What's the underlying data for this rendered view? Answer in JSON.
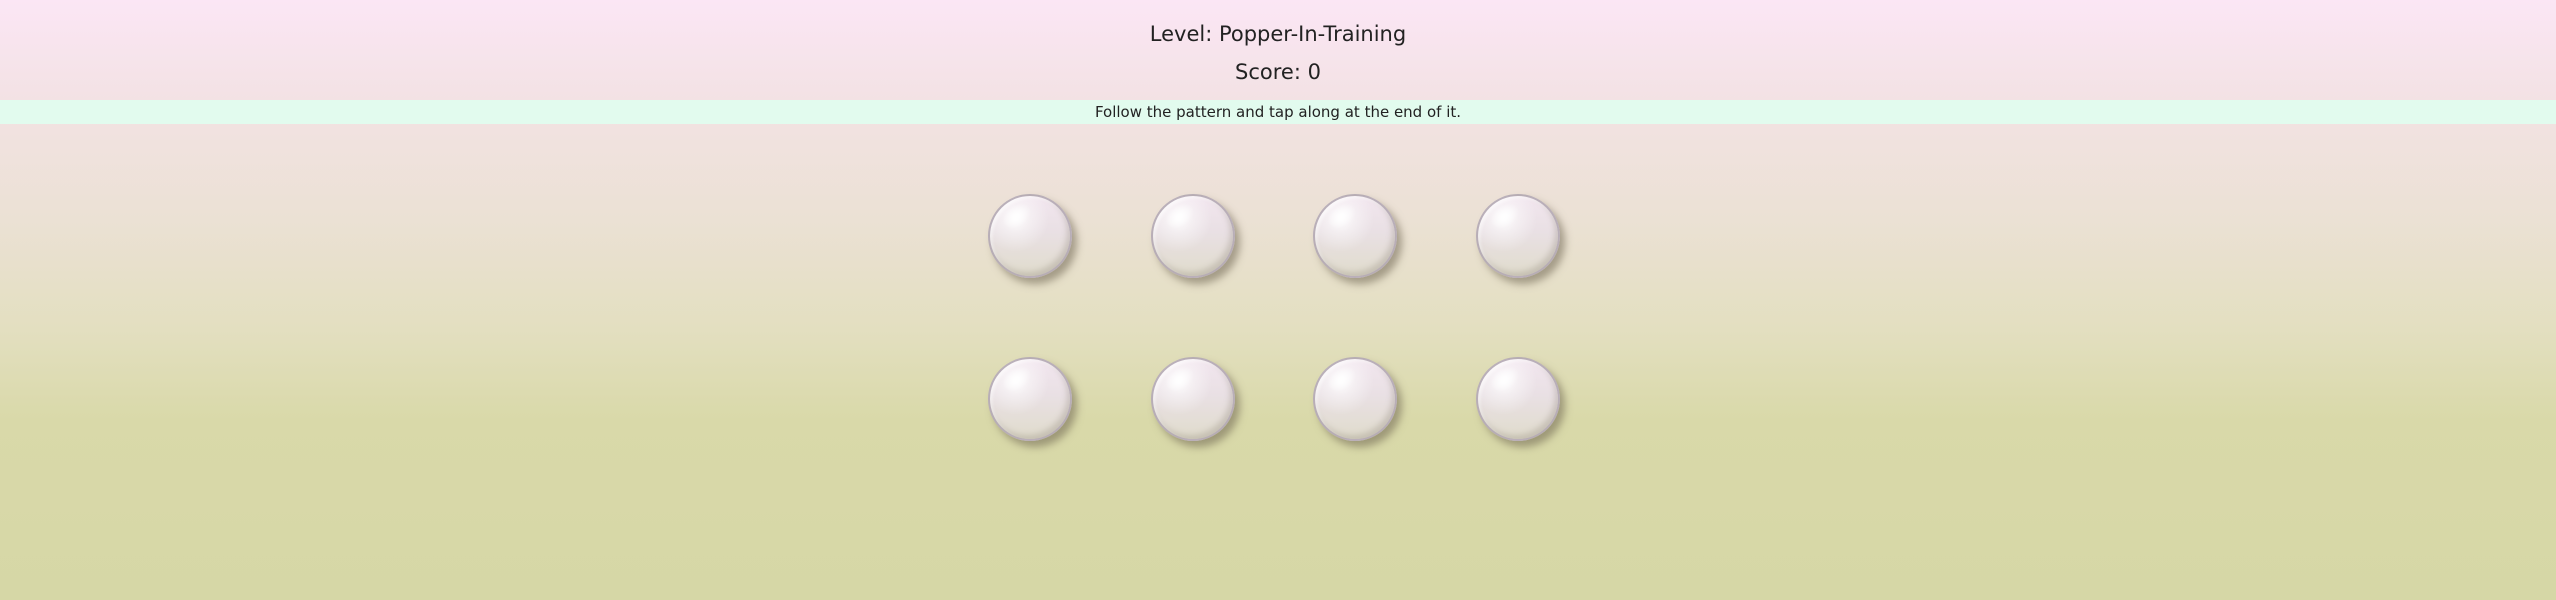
{
  "header": {
    "level_text": "Level: Popper-In-Training",
    "score_text": "Score: 0"
  },
  "instruction": {
    "text": "Follow the pattern and tap along at the end of it."
  },
  "board": {
    "rows": 2,
    "columns": 4,
    "bubbles": [
      {
        "state": "idle"
      },
      {
        "state": "idle"
      },
      {
        "state": "idle"
      },
      {
        "state": "idle"
      },
      {
        "state": "idle"
      },
      {
        "state": "idle"
      },
      {
        "state": "idle"
      },
      {
        "state": "idle"
      }
    ]
  },
  "colors": {
    "instruction_bar": "#e2fbee",
    "background_top": "#fbe6f5",
    "background_bottom": "#d6d7a6",
    "text": "#222222"
  }
}
